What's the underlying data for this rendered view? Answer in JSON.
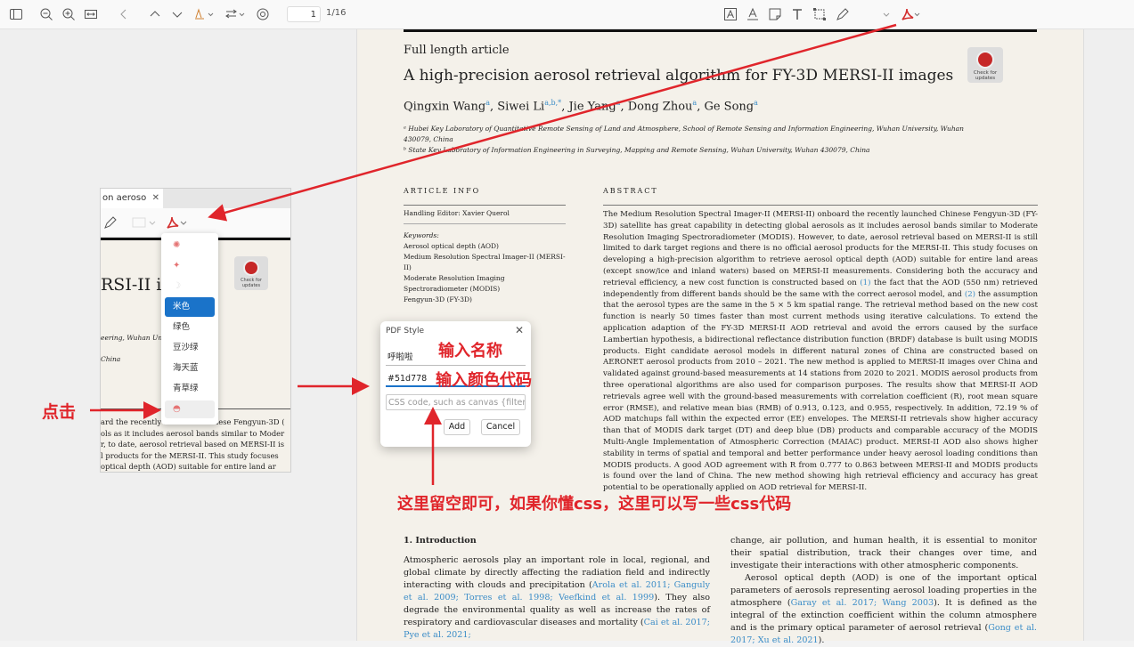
{
  "toolbar": {
    "page_number": "1",
    "page_total": "1/16"
  },
  "paper": {
    "article_type": "Full length article",
    "title": "A high-precision aerosol retrieval algorithm for FY-3D MERSI-II images",
    "authors": [
      {
        "name": "Qingxin Wang",
        "sup": "a"
      },
      {
        "name": "Siwei Li",
        "sup": "a,b,*"
      },
      {
        "name": "Jie Yang",
        "sup": "a"
      },
      {
        "name": "Dong Zhou",
        "sup": "a"
      },
      {
        "name": "Ge Song",
        "sup": "a"
      }
    ],
    "affiliation_a_line1": "ᵃ Hubei Key Laboratory of Quantitative Remote Sensing of Land and Atmosphere, School of Remote Sensing and Information Engineering, Wuhan University, Wuhan",
    "affiliation_a_line2": "430079, China",
    "affiliation_b": "ᵇ State Key Laboratory of Information Engineering in Surveying, Mapping and Remote Sensing, Wuhan University, Wuhan 430079, China",
    "badge_text": "Check for updates",
    "article_info_header": "ARTICLE INFO",
    "abstract_header": "ABSTRACT",
    "handling_editor": "Handling Editor: Xavier Querol",
    "keywords_label": "Keywords:",
    "keywords": [
      "Aerosol optical depth (AOD)",
      "Medium Resolution Spectral Imager-II (MERSI-",
      "II)",
      "Moderate Resolution Imaging",
      "Spectroradiometer (MODIS)",
      "Fengyun-3D (FY-3D)"
    ],
    "abstract_p1": "The Medium Resolution Spectral Imager-II (MERSI-II) onboard the recently launched Chinese Fengyun-3D (FY-3D) satellite has great capability in detecting global aerosols as it includes aerosol bands similar to Moderate Resolution Imaging Spectroradiometer (MODIS). However, to date, aerosol retrieval based on MERSI-II is still limited to dark target regions and there is no official aerosol products for the MERSI-II. This study focuses on developing a high-precision algorithm to retrieve aerosol optical depth (AOD) suitable for entire land areas (except snow/ice and inland waters) based on MERSI-II measurements. Considering both the accuracy and retrieval efficiency, a new cost function is constructed based on",
    "abstract_ref1": "(1)",
    "abstract_p2": "the fact that the AOD (550 nm) retrieved independently from different bands should be the same with the correct aerosol model, and",
    "abstract_ref2": "(2)",
    "abstract_p3": "the assumption that the aerosol types are the same in the 5 × 5 km spatial range. The retrieval method based on the new cost function is nearly 50 times faster than most current methods using iterative calculations. To extend the application adaption of the FY-3D MERSI-II AOD retrieval and avoid the errors caused by the surface Lambertian hypothesis, a bidirectional reflectance distribution function (BRDF) database is built using MODIS products. Eight candidate aerosol models in different natural zones of China are constructed based on AERONET aerosol products from 2010 – 2021. The new method is applied to MERSI-II images over China and validated against ground-based measurements at 14 stations from 2020 to 2021. MODIS aerosol products from three operational algorithms are also used for comparison purposes. The results show that MERSI-II AOD retrievals agree well with the ground-based measurements with correlation coefficient (R), root mean square error (RMSE), and relative mean bias (RMB) of 0.913, 0.123, and 0.955, respectively. In addition, 72.19 % of AOD matchups fall within the expected error (EE) envelopes. The MERSI-II retrievals show higher accuracy than that of MODIS dark target (DT) and deep blue (DB) products and comparable accuracy of the MODIS Multi-Angle Implementation of Atmospheric Correction (MAIAC) product. MERSI-II AOD also shows higher stability in terms of spatial and temporal and better performance under heavy aerosol loading conditions than MODIS products. A good AOD agreement with R from 0.777 to 0.863 between MERSI-II and MODIS products is found over the land of China. The new method showing high retrieval efficiency and accuracy has great potential to be operationally applied on AOD retrieval for MERSI-II.",
    "intro_heading": "1.  Introduction",
    "intro_p1": "Atmospheric aerosols play an important role in local, regional, and global climate by directly affecting the radiation field and indirectly interacting with clouds and precipitation (",
    "intro_ref1": "Arola et al. 2011; Ganguly et al. 2009; Torres et al. 1998; Veefkind et al. 1999",
    "intro_p1b": "). They also degrade the environmental quality as well as increase the rates of respiratory and cardiovascular diseases and mortality (",
    "intro_ref2": "Cai et al. 2017; Pye et al. 2021;",
    "col2_p1": "change, air pollution, and human health, it is essential to monitor their spatial distribution, track their changes over time, and investigate their interactions with other atmospheric components.",
    "col2_p2": "Aerosol optical depth (AOD) is one of the important optical parameters of aerosols representing aerosol loading properties in the atmosphere (",
    "col2_ref1": "Garay et al. 2017; Wang 2003",
    "col2_p2b": "). It is defined as the integral of the extinction coefficient within the column atmosphere and is the primary optical parameter of aerosol retrieval (",
    "col2_ref2": "Gong et al. 2017; Xu et al. 2021",
    "col2_p2c": ")."
  },
  "inset": {
    "tab_label": "on aeroso",
    "page_title_fragment": "RSI-II ima",
    "aff_fragment_1": "eering, Wuhan Uni",
    "aff_fragment_2": "China",
    "badge_text": "Check for updates",
    "text_lines": [
      "ard the recently launched Chinese Fengyun-3D (",
      "ols as it includes aerosol bands similar to Moder",
      "r, to date, aerosol retrieval based on MERSI-II is",
      "l products for the MERSI-II. This study focuses",
      "optical depth (AOD) suitable for entire land ar"
    ]
  },
  "style_menu": {
    "items": [
      "",
      "",
      "",
      "米色",
      "绿色",
      "豆沙绿",
      "海天蓝",
      "青草绿",
      ""
    ],
    "selected": "米色"
  },
  "dialog": {
    "title": "PDF Style",
    "name_value": "呼啦啦",
    "color_value": "#51d778",
    "css_placeholder": "CSS code, such as canvas {filter:",
    "add_label": "Add",
    "cancel_label": "Cancel"
  },
  "annotations": {
    "click": "点击",
    "enter_name": "输入名称",
    "enter_color": "输入颜色代码",
    "css_note": "这里留空即可，如果你懂css，这里可以写一些css代码"
  },
  "colors": {
    "annotation_red": "#e0252b",
    "selection_blue": "#1a73c9",
    "link_blue": "#3a8cc7",
    "paper_bg": "#f4f1ea"
  }
}
